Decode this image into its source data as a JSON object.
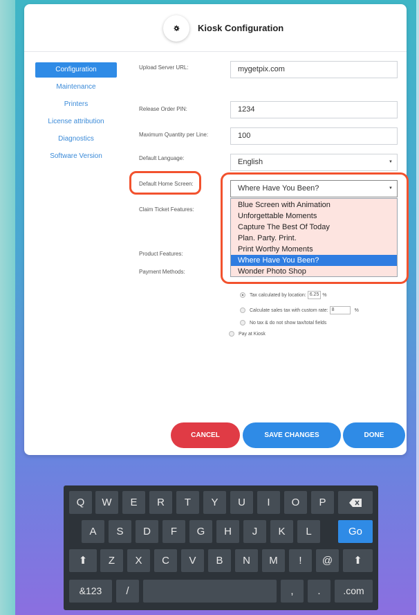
{
  "header": {
    "title": "Kiosk Configuration",
    "icon": "gear-icon"
  },
  "sidebar": {
    "items": [
      {
        "label": "Configuration",
        "active": true
      },
      {
        "label": "Maintenance",
        "active": false
      },
      {
        "label": "Printers",
        "active": false
      },
      {
        "label": "License attribution",
        "active": false
      },
      {
        "label": "Diagnostics",
        "active": false
      },
      {
        "label": "Software Version",
        "active": false
      }
    ]
  },
  "form": {
    "upload_server_url_label": "Upload Server URL:",
    "upload_server_url_value": "mygetpix.com",
    "release_order_pin_label": "Release Order PIN:",
    "release_order_pin_value": "1234",
    "max_quantity_label": "Maximum Quantity per Line:",
    "max_quantity_value": "100",
    "default_language_label": "Default Language:",
    "default_language_value": "English",
    "default_home_screen_label": "Default Home Screen:",
    "default_home_screen_value": "Where Have You Been?",
    "claim_ticket_label": "Claim Ticket Features:",
    "product_features_label": "Product Features:",
    "payment_methods_label": "Payment Methods:"
  },
  "dropdown": {
    "options": [
      "Blue Screen with Animation",
      "Unforgettable Moments",
      "Capture The Best Of Today",
      "Plan. Party. Print.",
      "Print Worthy Moments",
      "Where Have You Been?",
      "Wonder Photo Shop"
    ],
    "selected_index": 5
  },
  "tax": {
    "by_location_label": "Tax calculated by location:",
    "by_location_value": "6.25",
    "percent": "%",
    "custom_rate_label": "Calculate sales tax with custom rate:",
    "custom_rate_value": "8",
    "no_tax_label": "No tax & do not show tax/total fields",
    "pay_at_kiosk_label": "Pay at Kiosk"
  },
  "buttons": {
    "cancel": "CANCEL",
    "save": "SAVE CHANGES",
    "done": "DONE"
  },
  "keyboard": {
    "row1": [
      "Q",
      "W",
      "E",
      "R",
      "T",
      "Y",
      "U",
      "I",
      "O",
      "P"
    ],
    "row2": [
      "A",
      "S",
      "D",
      "F",
      "G",
      "H",
      "J",
      "K",
      "L"
    ],
    "go": "Go",
    "row3": [
      "Z",
      "X",
      "C",
      "V",
      "B",
      "N",
      "M",
      "!",
      "@"
    ],
    "row4_left": "&123",
    "slash": "/",
    "comma": ",",
    "dot": ".",
    "dotcom": ".com"
  },
  "colors": {
    "accent": "#2f8be6",
    "cancel": "#e03b45",
    "highlight": "#f2522e"
  }
}
